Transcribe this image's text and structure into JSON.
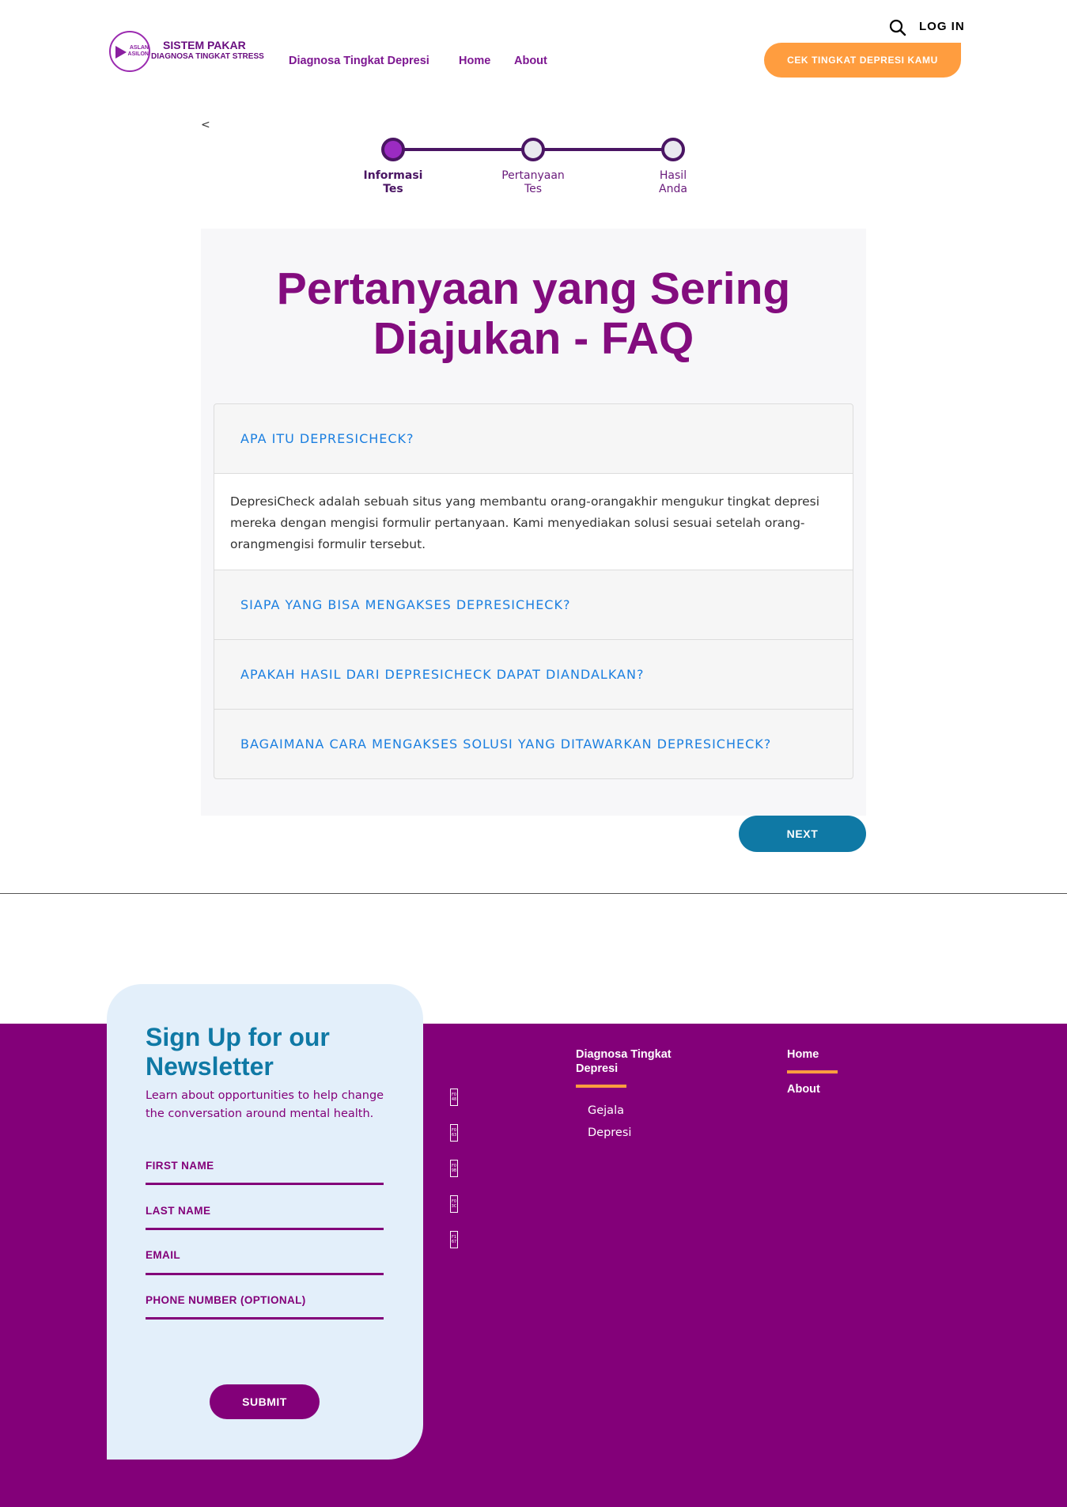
{
  "header": {
    "logo_text": "ASLAN ASILON",
    "brand_title": "SISTEM PAKAR",
    "brand_subtitle": "DIAGNOSA TINGKAT STRESS",
    "nav": [
      "Diagnosa Tingkat Depresi",
      "Home",
      "About"
    ],
    "login_label": "LOG IN",
    "cta_label": "CEK TINGKAT DEPRESI KAMU"
  },
  "stepper": {
    "back_label": "<",
    "steps": [
      {
        "line1": "Informasi",
        "line2": "Tes",
        "active": true
      },
      {
        "line1": "Pertanyaan",
        "line2": "Tes",
        "active": false
      },
      {
        "line1": "Hasil",
        "line2": "Anda",
        "active": false
      }
    ]
  },
  "faq": {
    "title_line1": "Pertanyaan yang Sering",
    "title_line2": "Diajukan - FAQ",
    "items": [
      {
        "question": "APA ITU DEPRESICHECK?",
        "answer": "DepresiCheck adalah sebuah situs yang membantu orang-orangakhir mengukur tingkat depresi mereka dengan mengisi formulir pertanyaan. Kami menyediakan solusi sesuai setelah orang-orangmengisi formulir tersebut.",
        "expanded": true
      },
      {
        "question": "SIAPA YANG BISA MENGAKSES DEPRESICHECK?",
        "expanded": false
      },
      {
        "question": "APAKAH HASIL DARI DEPRESICHECK DAPAT DIANDALKAN?",
        "expanded": false
      },
      {
        "question": "BAGAIMANA CARA MENGAKSES SOLUSI YANG DITAWARKAN DEPRESICHECK?",
        "expanded": false
      }
    ],
    "next_label": "NEXT"
  },
  "newsletter": {
    "title": "Sign Up for our Newsletter",
    "description": "Learn about opportunities to help change the conversation around mental health.",
    "fields": [
      "FIRST NAME",
      "LAST NAME",
      "EMAIL",
      "PHONE NUMBER (OPTIONAL)"
    ],
    "submit_label": "SUBMIT"
  },
  "social_icons": [
    {
      "name": "facebook-icon",
      "glyph": "F0 48"
    },
    {
      "name": "instagram-icon",
      "glyph": "F0 63"
    },
    {
      "name": "twitter-icon",
      "glyph": "F0 9B"
    },
    {
      "name": "linkedin-icon",
      "glyph": "F0 3C"
    },
    {
      "name": "youtube-icon",
      "glyph": "F1 67"
    }
  ],
  "footer": {
    "col1_heading_line1": "Diagnosa Tingkat",
    "col1_heading_line2": "Depresi",
    "col1_links": [
      "Gejala",
      "Depresi"
    ],
    "col2_links": [
      "Home",
      "About"
    ]
  },
  "colors": {
    "brand_purple": "#830079",
    "accent_orange": "#ff9d3f",
    "accent_blue": "#0f79a5",
    "link_blue": "#1b7fe0"
  }
}
